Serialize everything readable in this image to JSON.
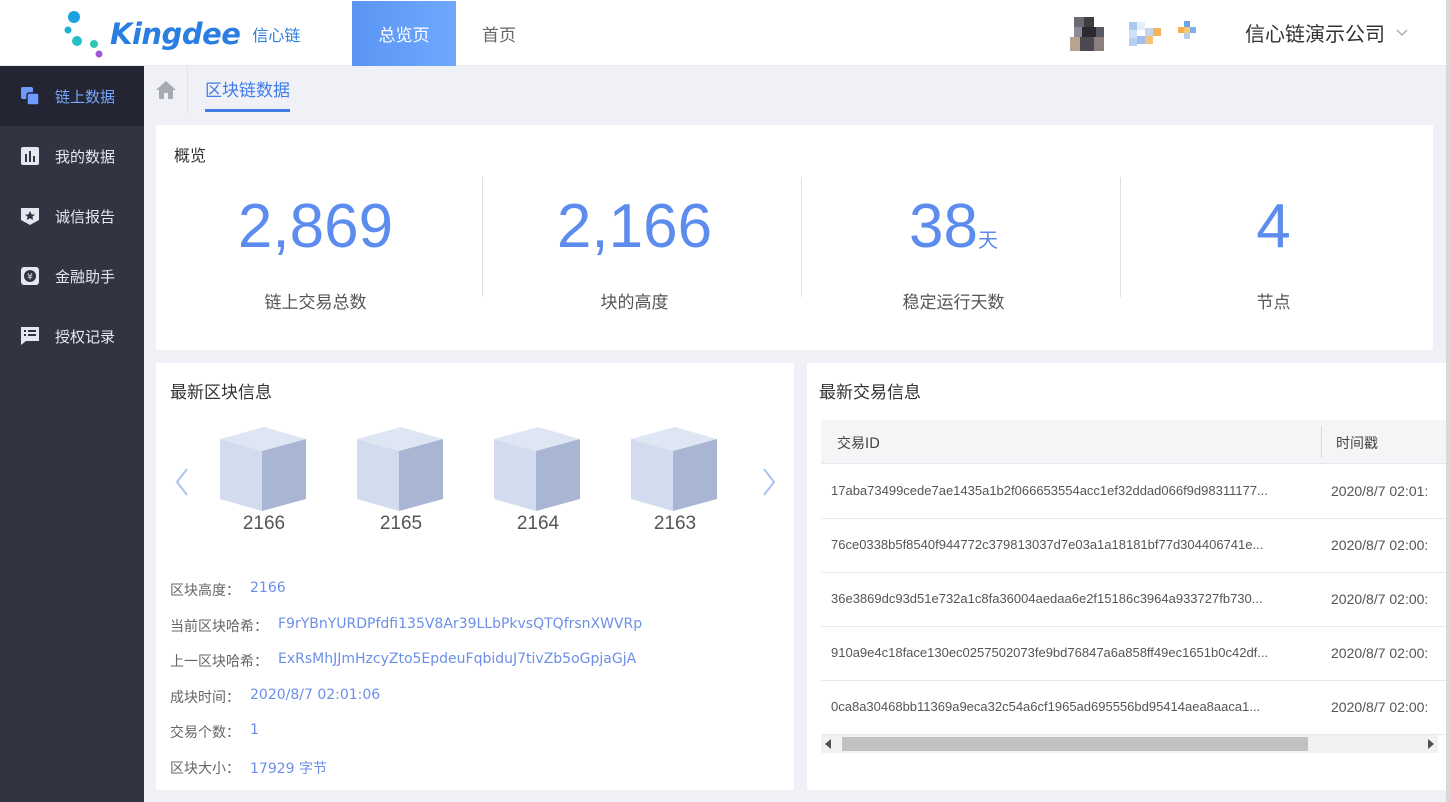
{
  "header": {
    "logo_text": "Kingdee",
    "logo_sub": "信心链",
    "tabs": [
      {
        "label": "总览页",
        "active": true
      },
      {
        "label": "首页",
        "active": false
      }
    ],
    "company": "信心链演示公司"
  },
  "sidebar": {
    "items": [
      {
        "label": "链上数据",
        "icon": "chain-data-icon",
        "active": true
      },
      {
        "label": "我的数据",
        "icon": "bar-chart-icon",
        "active": false
      },
      {
        "label": "诚信报告",
        "icon": "star-badge-icon",
        "active": false
      },
      {
        "label": "金融助手",
        "icon": "yen-icon",
        "active": false
      },
      {
        "label": "授权记录",
        "icon": "list-icon",
        "active": false
      }
    ]
  },
  "breadcrumb": {
    "current": "区块链数据"
  },
  "overview": {
    "title": "概览",
    "stats": [
      {
        "value": "2,869",
        "unit": "",
        "label": "链上交易总数"
      },
      {
        "value": "2,166",
        "unit": "",
        "label": "块的高度"
      },
      {
        "value": "38",
        "unit": "天",
        "label": "稳定运行天数"
      },
      {
        "value": "4",
        "unit": "",
        "label": "节点"
      }
    ]
  },
  "blocks": {
    "title": "最新区块信息",
    "cubes": [
      "2166",
      "2165",
      "2164",
      "2163"
    ],
    "details": [
      {
        "label": "区块高度：",
        "value": "2166"
      },
      {
        "label": "当前区块哈希：",
        "value": "F9rYBnYURDPfdfi135V8Ar39LLbPkvsQTQfrsnXWVRp"
      },
      {
        "label": "上一区块哈希：",
        "value": "ExRsMhJJmHzcyZto5EpdeuFqbiduJ7tivZb5oGpjaGjA"
      },
      {
        "label": "成块时间：",
        "value": "2020/8/7 02:01:06"
      },
      {
        "label": "交易个数：",
        "value": "1"
      },
      {
        "label": "区块大小：",
        "value": "17929 字节"
      }
    ]
  },
  "transactions": {
    "title": "最新交易信息",
    "columns": [
      "交易ID",
      "时间戳"
    ],
    "rows": [
      {
        "id": "17aba73499cede7ae1435a1b2f066653554acc1ef32ddad066f9d98311177...",
        "ts": "2020/8/7 02:01:"
      },
      {
        "id": "76ce0338b5f8540f944772c379813037d7e03a1a18181bf77d304406741e...",
        "ts": "2020/8/7 02:00:"
      },
      {
        "id": "36e3869dc93d51e732a1c8fa36004aedaa6e2f15186c3964a933727fb730...",
        "ts": "2020/8/7 02:00:"
      },
      {
        "id": "910a9e4c18face130ec0257502073fe9bd76847a6a858ff49ec1651b0c42df...",
        "ts": "2020/8/7 02:00:"
      },
      {
        "id": "0ca8a30468bb11369a9eca32c54a6cf1965ad695556bd95414aea8aaca1...",
        "ts": "2020/8/7 02:00:"
      }
    ]
  }
}
